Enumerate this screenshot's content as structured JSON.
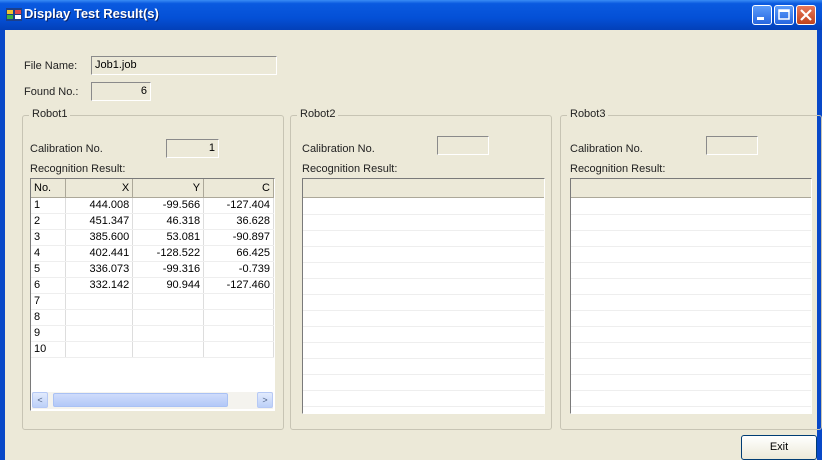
{
  "window": {
    "title": "Display Test Result(s)"
  },
  "file": {
    "label": "File Name:",
    "value": "Job1.job"
  },
  "found": {
    "label": "Found No.:",
    "value": "6"
  },
  "robots": [
    {
      "title": "Robot1",
      "calibration_label": "Calibration No.",
      "calibration_value": "1",
      "recognition_label": "Recognition Result:",
      "columns": [
        "No.",
        "X",
        "Y",
        "C"
      ],
      "rows": [
        [
          "1",
          "444.008",
          "-99.566",
          "-127.404"
        ],
        [
          "2",
          "451.347",
          "46.318",
          "36.628"
        ],
        [
          "3",
          "385.600",
          "53.081",
          "-90.897"
        ],
        [
          "4",
          "402.441",
          "-128.522",
          "66.425"
        ],
        [
          "5",
          "336.073",
          "-99.316",
          "-0.739"
        ],
        [
          "6",
          "332.142",
          "90.944",
          "-127.460"
        ],
        [
          "7",
          "",
          "",
          ""
        ],
        [
          "8",
          "",
          "",
          ""
        ],
        [
          "9",
          "",
          "",
          ""
        ],
        [
          "10",
          "",
          "",
          ""
        ]
      ]
    },
    {
      "title": "Robot2",
      "calibration_label": "Calibration No.",
      "calibration_value": "",
      "recognition_label": "Recognition Result:"
    },
    {
      "title": "Robot3",
      "calibration_label": "Calibration No.",
      "calibration_value": "",
      "recognition_label": "Recognition Result:"
    }
  ],
  "buttons": {
    "exit": "Exit"
  },
  "scroll": {
    "left_arrow": "<",
    "right_arrow": ">"
  }
}
